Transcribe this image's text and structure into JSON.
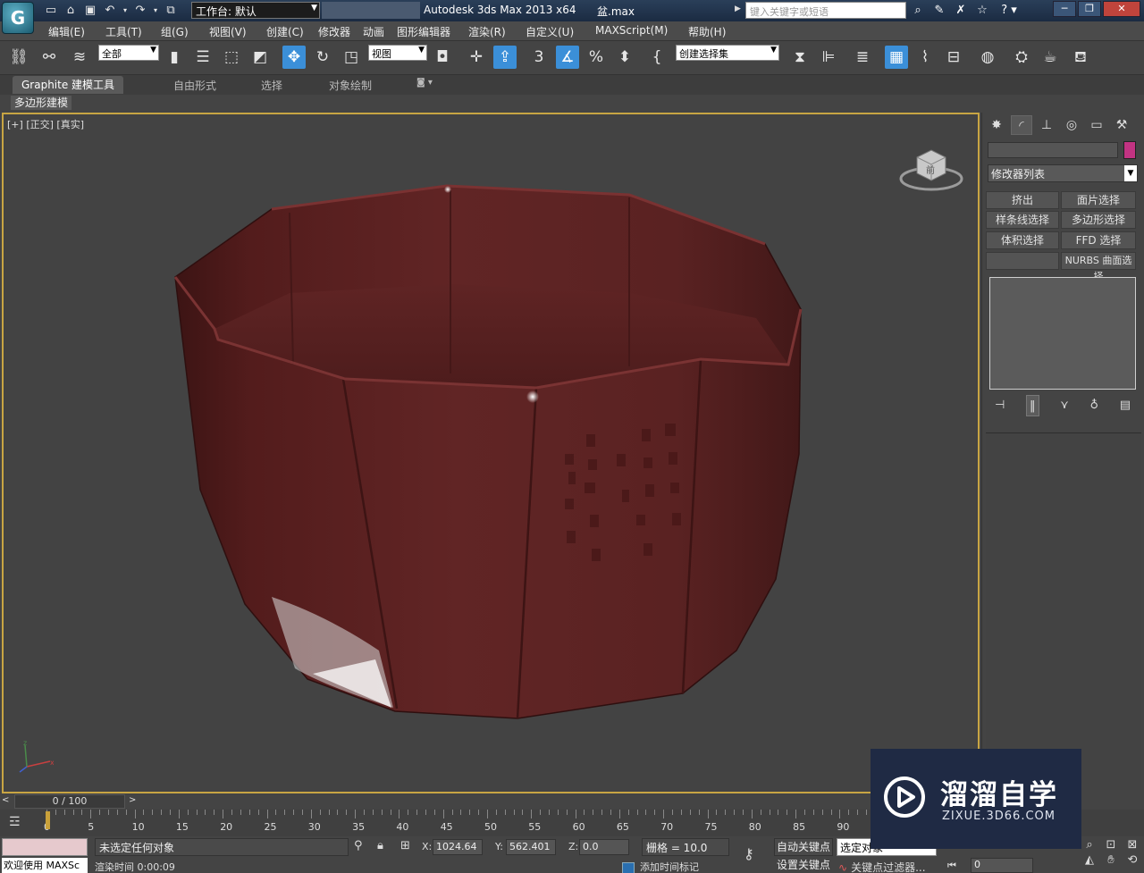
{
  "title_bar": {
    "workspace_label": "工作台: 默认",
    "app_title": "Autodesk 3ds Max  2013 x64",
    "file_name": "盆.max",
    "search_placeholder": "键入关键字或短语"
  },
  "menu": [
    "编辑(E)",
    "工具(T)",
    "组(G)",
    "视图(V)",
    "创建(C)",
    "修改器",
    "动画",
    "图形编辑器",
    "渲染(R)",
    "自定义(U)",
    "MAXScript(M)",
    "帮助(H)"
  ],
  "toolbar": {
    "selection_filter": "全部",
    "ref_coord": "视图",
    "snap_label": "3",
    "named_selection": "创建选择集"
  },
  "ribbon": {
    "tabs": [
      "Graphite 建模工具",
      "自由形式",
      "选择",
      "对象绘制"
    ],
    "active_tab_index": 0,
    "subtab": "多边形建模"
  },
  "viewport": {
    "label_plus": "[+]",
    "label_view": "[正交]",
    "label_shading": "[真实]",
    "viewcube_face": "前"
  },
  "command_panel": {
    "modifier_list": "修改器列表",
    "buttons": [
      "挤出",
      "面片选择",
      "样条线选择",
      "多边形选择",
      "体积选择",
      "FFD 选择",
      "",
      "NURBS 曲面选择"
    ],
    "swatch_color": "#c23382"
  },
  "time_slider": {
    "position": "0 / 100",
    "ticks": [
      "0",
      "5",
      "10",
      "15",
      "20",
      "25",
      "30",
      "35",
      "40",
      "45",
      "50",
      "55",
      "60",
      "65",
      "70",
      "75",
      "80",
      "85",
      "90"
    ]
  },
  "status": {
    "welcome": "欢迎使用 MAXSc",
    "message": "未选定任何对象",
    "render_time": "渲染时间  0:00:09",
    "x_label": "X:",
    "x_value": "1024.64",
    "y_label": "Y:",
    "y_value": "562.401",
    "z_label": "Z:",
    "z_value": "0.0",
    "grid": "栅格 = 10.0",
    "add_time_tag": "添加时间标记",
    "auto_key": "自动关键点",
    "set_key": "设置关键点",
    "selected_dropdown": "选定对象",
    "key_filters": "关键点过滤器...",
    "current_frame": "0"
  },
  "watermark": {
    "title": "溜溜自学",
    "url": "ZIXUE.3D66.COM"
  }
}
